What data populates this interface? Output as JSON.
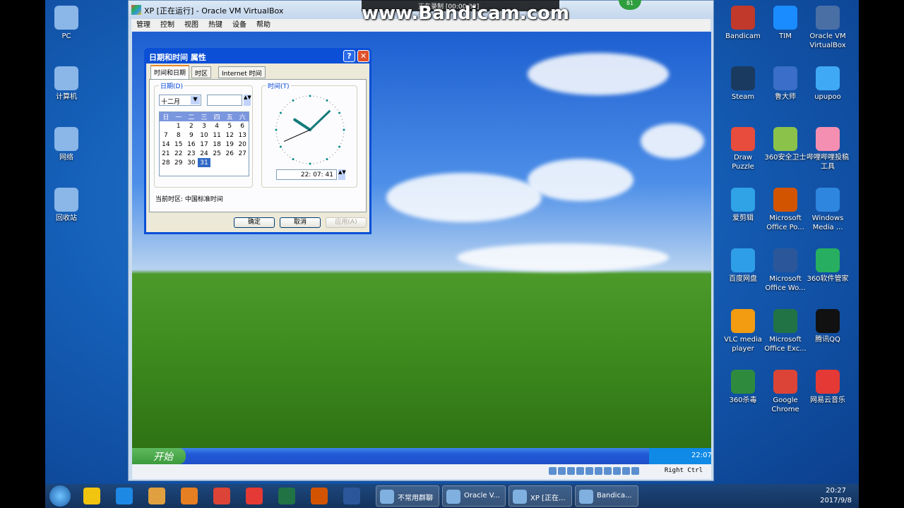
{
  "recorder": {
    "watermark": "www.Bandicam.com",
    "status": "正在录制 [00:00:32]",
    "badge": "81"
  },
  "desktop_left": [
    {
      "label": "PC"
    },
    {
      "label": "计算机"
    },
    {
      "label": "网络"
    },
    {
      "label": "回收站"
    }
  ],
  "desktop_right": [
    {
      "label": "Bandicam",
      "color": "#c0392b"
    },
    {
      "label": "TIM",
      "color": "#1a8cff"
    },
    {
      "label": "Oracle VM VirtualBox",
      "color": "#4a6fa5"
    },
    {
      "label": "Steam",
      "color": "#1b3a60"
    },
    {
      "label": "鲁大师",
      "color": "#3a6ec8"
    },
    {
      "label": "upupoo",
      "color": "#3fa9f5"
    },
    {
      "label": "Draw Puzzle",
      "color": "#e74c3c"
    },
    {
      "label": "360安全卫士",
      "color": "#8bc34a"
    },
    {
      "label": "哔哩哔哩投稿工具",
      "color": "#f48fb1"
    },
    {
      "label": "爱剪辑",
      "color": "#2fa3e6"
    },
    {
      "label": "Microsoft Office Po...",
      "color": "#d35400"
    },
    {
      "label": "Windows Media ...",
      "color": "#2e86de"
    },
    {
      "label": "百度网盘",
      "color": "#2f9ee8"
    },
    {
      "label": "Microsoft Office Wo...",
      "color": "#2b579a"
    },
    {
      "label": "360软件管家",
      "color": "#27ae60"
    },
    {
      "label": "VLC media player",
      "color": "#f39c12"
    },
    {
      "label": "Microsoft Office Exc...",
      "color": "#217346"
    },
    {
      "label": "腾讯QQ",
      "color": "#111111"
    },
    {
      "label": "360杀毒",
      "color": "#2e8b3e"
    },
    {
      "label": "Google Chrome",
      "color": "#db4437"
    },
    {
      "label": "网易云音乐",
      "color": "#e53935"
    }
  ],
  "vbox": {
    "title": "XP [正在运行] - Oracle VM VirtualBox",
    "menu": [
      "管理",
      "控制",
      "视图",
      "热键",
      "设备",
      "帮助"
    ],
    "status_key": "Right Ctrl"
  },
  "xp": {
    "start": "开始",
    "tray_time": "22:07"
  },
  "dialog": {
    "title": "日期和时间 属性",
    "help": "?",
    "close": "✕",
    "tabs": [
      "时间和日期",
      "时区",
      "Internet 时间"
    ],
    "date_group": "日期(D)",
    "month": "十二月",
    "year": "",
    "weekdays": [
      "日",
      "一",
      "二",
      "三",
      "四",
      "五",
      "六"
    ],
    "weeks": [
      [
        "",
        "1",
        "2",
        "3",
        "4",
        "5",
        "6"
      ],
      [
        "7",
        "8",
        "9",
        "10",
        "11",
        "12",
        "13"
      ],
      [
        "14",
        "15",
        "16",
        "17",
        "18",
        "19",
        "20"
      ],
      [
        "21",
        "22",
        "23",
        "24",
        "25",
        "26",
        "27"
      ],
      [
        "28",
        "29",
        "30",
        "31",
        "",
        "",
        ""
      ]
    ],
    "selected_day": "31",
    "time_group": "时间(T)",
    "time": "22: 07: 41",
    "timezone": "当前时区: 中国标准时间",
    "ok": "确定",
    "cancel": "取消",
    "apply": "应用(A)"
  },
  "taskbar": {
    "windows": [
      "不常用群聊",
      "Oracle V...",
      "XP [正在...",
      "Bandica..."
    ],
    "time": "20:27",
    "date": "2017/9/8"
  }
}
